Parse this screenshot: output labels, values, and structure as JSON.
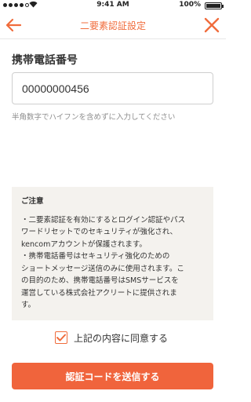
{
  "status_bar": {
    "time": "9:41 AM",
    "battery": "100%",
    "icons": [
      "signal-dots-icon",
      "wifi-icon",
      "battery-icon"
    ]
  },
  "nav": {
    "title": "二要素認証設定",
    "back_icon": "arrow-left-icon",
    "close_icon": "close-icon",
    "accent_color": "#f06c3c"
  },
  "form": {
    "label": "携帯電話番号",
    "phone_value": "00000000456",
    "hint": "半角数字でハイフンを含めずに入力してください"
  },
  "notice": {
    "title": "ご注意",
    "lines": [
      "・二要素認証を有効にするとログイン認証やパス",
      "ワードリセットでのセキュリティが強化され、",
      "kencomアカウントが保護されます。",
      "・携帯電話番号はセキュリティ強化のための",
      "ショートメッセージ送信のみに使用されます。こ",
      "の目的のため、携帯電話番号はSMSサービスを",
      "運営している株式会社アクリートに提供されま",
      "す。"
    ],
    "background": "#f4f2ee"
  },
  "agreement": {
    "label": "上記の内容に同意する",
    "checked": true,
    "check_icon": "checkmark-icon"
  },
  "submit": {
    "label": "認証コードを送信する",
    "color": "#f0643c"
  }
}
